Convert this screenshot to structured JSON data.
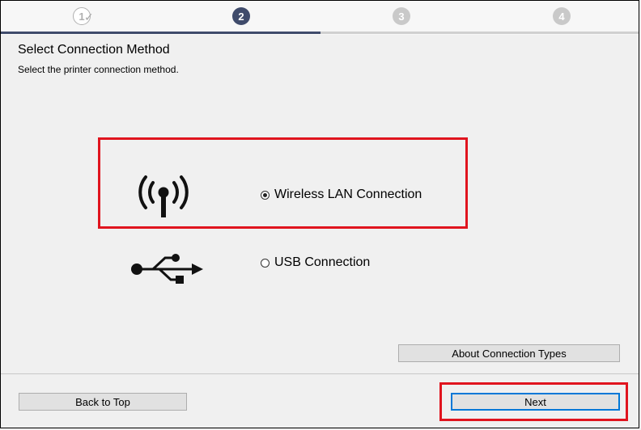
{
  "steps": [
    {
      "number": "1",
      "state": "done"
    },
    {
      "number": "2",
      "state": "current"
    },
    {
      "number": "3",
      "state": "future"
    },
    {
      "number": "4",
      "state": "future"
    }
  ],
  "page": {
    "title": "Select Connection Method",
    "subtitle": "Select the printer connection method."
  },
  "options": {
    "wireless": {
      "label": "Wireless LAN Connection",
      "selected": true,
      "icon": "wireless-antenna-icon"
    },
    "usb": {
      "label": "USB Connection",
      "selected": false,
      "icon": "usb-icon"
    }
  },
  "buttons": {
    "about": "About Connection Types",
    "back": "Back to Top",
    "next": "Next"
  },
  "colors": {
    "accent": "#3f4b6b",
    "highlight": "#e0141e",
    "focus": "#0078d7"
  }
}
